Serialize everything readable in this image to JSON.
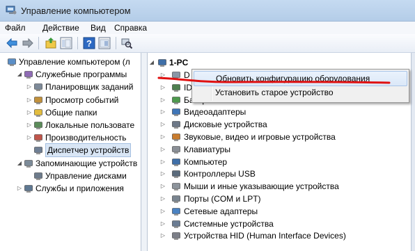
{
  "window": {
    "title": "Управление компьютером"
  },
  "menu": [
    "Файл",
    "Действие",
    "Вид",
    "Справка"
  ],
  "left_tree": [
    {
      "label": "Управление компьютером (л",
      "level": 0,
      "expander": "",
      "icon": "computer-management-icon"
    },
    {
      "label": "Служебные программы",
      "level": 1,
      "expander": "◢",
      "icon": "tools-icon"
    },
    {
      "label": "Планировщик заданий",
      "level": 2,
      "expander": "▷",
      "icon": "clock-icon"
    },
    {
      "label": "Просмотр событий",
      "level": 2,
      "expander": "▷",
      "icon": "event-viewer-icon"
    },
    {
      "label": "Общие папки",
      "level": 2,
      "expander": "▷",
      "icon": "shared-folder-icon"
    },
    {
      "label": "Локальные пользовате",
      "level": 2,
      "expander": "▷",
      "icon": "users-icon"
    },
    {
      "label": "Производительность",
      "level": 2,
      "expander": "▷",
      "icon": "performance-icon"
    },
    {
      "label": "Диспетчер устройств",
      "level": 2,
      "expander": "",
      "icon": "device-manager-icon",
      "selected": true
    },
    {
      "label": "Запоминающие устройств",
      "level": 1,
      "expander": "◢",
      "icon": "storage-icon"
    },
    {
      "label": "Управление дисками",
      "level": 2,
      "expander": "",
      "icon": "disk-management-icon"
    },
    {
      "label": "Службы и приложения",
      "level": 1,
      "expander": "▷",
      "icon": "services-icon"
    }
  ],
  "device_tree": {
    "root": "1-PC",
    "categories": [
      {
        "label": "D",
        "icon": "dvd-icon"
      },
      {
        "label": "ID",
        "icon": "ide-icon"
      },
      {
        "label": "Батареи",
        "icon": "battery-icon"
      },
      {
        "label": "Видеоадаптеры",
        "icon": "display-adapter-icon"
      },
      {
        "label": "Дисковые устройства",
        "icon": "disk-drive-icon"
      },
      {
        "label": "Звуковые, видео и игровые устройства",
        "icon": "sound-icon"
      },
      {
        "label": "Клавиатуры",
        "icon": "keyboard-icon"
      },
      {
        "label": "Компьютер",
        "icon": "computer-icon"
      },
      {
        "label": "Контроллеры USB",
        "icon": "usb-icon"
      },
      {
        "label": "Мыши и иные указывающие устройства",
        "icon": "mouse-icon"
      },
      {
        "label": "Порты (COM и LPT)",
        "icon": "port-icon"
      },
      {
        "label": "Сетевые адаптеры",
        "icon": "network-icon"
      },
      {
        "label": "Системные устройства",
        "icon": "system-device-icon"
      },
      {
        "label": "Устройства HID (Human Interface Devices)",
        "icon": "hid-icon"
      }
    ]
  },
  "context_menu": {
    "items": [
      "Обновить конфигурацию оборудования",
      "Установить старое устройство"
    ],
    "highlighted_index": 0
  },
  "annotation_color": "#e01010",
  "selection_color": "#d9e6f5"
}
